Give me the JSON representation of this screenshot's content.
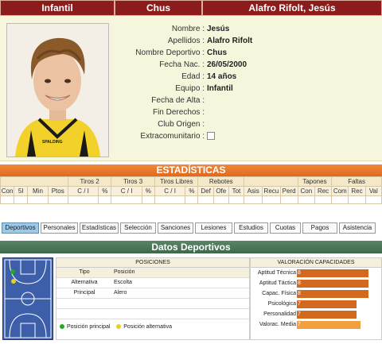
{
  "header": {
    "category": "Infantil",
    "nickname": "Chus",
    "fullname": "Alafro Rifolt, Jesús"
  },
  "player": {
    "fields": [
      {
        "label": "Nombre :",
        "value": "Jesús"
      },
      {
        "label": "Apellidos :",
        "value": "Alafro Rifolt"
      },
      {
        "label": "Nombre Deportivo :",
        "value": "Chus"
      },
      {
        "label": "Fecha Nac. :",
        "value": "26/05/2000"
      },
      {
        "label": "Edad :",
        "value": "14 años"
      },
      {
        "label": "Equipo :",
        "value": "Infantil"
      },
      {
        "label": "Fecha de Alta :",
        "value": ""
      },
      {
        "label": "Fin Derechos :",
        "value": ""
      },
      {
        "label": "Club Origen :",
        "value": ""
      },
      {
        "label": "Extracomunitario :",
        "value": ""
      }
    ]
  },
  "stats": {
    "title": "ESTADÍSTICAS",
    "groups": [
      "Tiros 2",
      "Tiros 3",
      "Tiros Libres",
      "Rebotes",
      "Tapones",
      "Faltas"
    ],
    "cols": [
      "Con",
      "5I",
      "Min",
      "Ptos",
      "C / I",
      "%",
      "C / I",
      "%",
      "C / I",
      "%",
      "Def",
      "Ofe",
      "Tot",
      "Asis",
      "Recu",
      "Perd",
      "Con",
      "Rec",
      "Com",
      "Rec",
      "Val"
    ]
  },
  "tabs": [
    {
      "label": "Deportivos",
      "active": true
    },
    {
      "label": "Personales",
      "active": false
    },
    {
      "label": "Estadísticas",
      "active": false
    },
    {
      "label": "Selección",
      "active": false
    },
    {
      "label": "Sanciones",
      "active": false
    },
    {
      "label": "Lesiones",
      "active": false
    },
    {
      "label": "Estudios",
      "active": false
    },
    {
      "label": "Cuotas",
      "active": false
    },
    {
      "label": "Pagos",
      "active": false
    },
    {
      "label": "Asistencia",
      "active": false
    }
  ],
  "datos": {
    "title": "Datos Deportivos",
    "positions": {
      "title": "POSICIONES",
      "col_tipo": "Tipo",
      "col_posicion": "Posición",
      "rows": [
        {
          "tipo": "Alternativa",
          "posicion": "Escolta"
        },
        {
          "tipo": "Principal",
          "posicion": "Alero"
        }
      ],
      "legend_main": "Posición principal",
      "legend_alt": "Posición alternativa"
    },
    "valoracion": {
      "title": "VALORACIÓN CAPACIDADES",
      "items": [
        {
          "label": "Aptitud Técnica",
          "value": "8",
          "level": 0.9
        },
        {
          "label": "Aptitud Táctica",
          "value": "8",
          "level": 0.9
        },
        {
          "label": "Capac. Física",
          "value": "8",
          "level": 0.9
        },
        {
          "label": "Psicológica",
          "value": "7",
          "level": 0.75
        },
        {
          "label": "Personalidad",
          "value": "7",
          "level": 0.75
        },
        {
          "label": "Valorac. Media",
          "value": "7",
          "level": 0.8
        }
      ]
    }
  },
  "colors": {
    "header": "#8c1c1c",
    "stats": "#e0681c",
    "datos": "#3e6a4c",
    "tab_active": "#9cc9e8"
  }
}
